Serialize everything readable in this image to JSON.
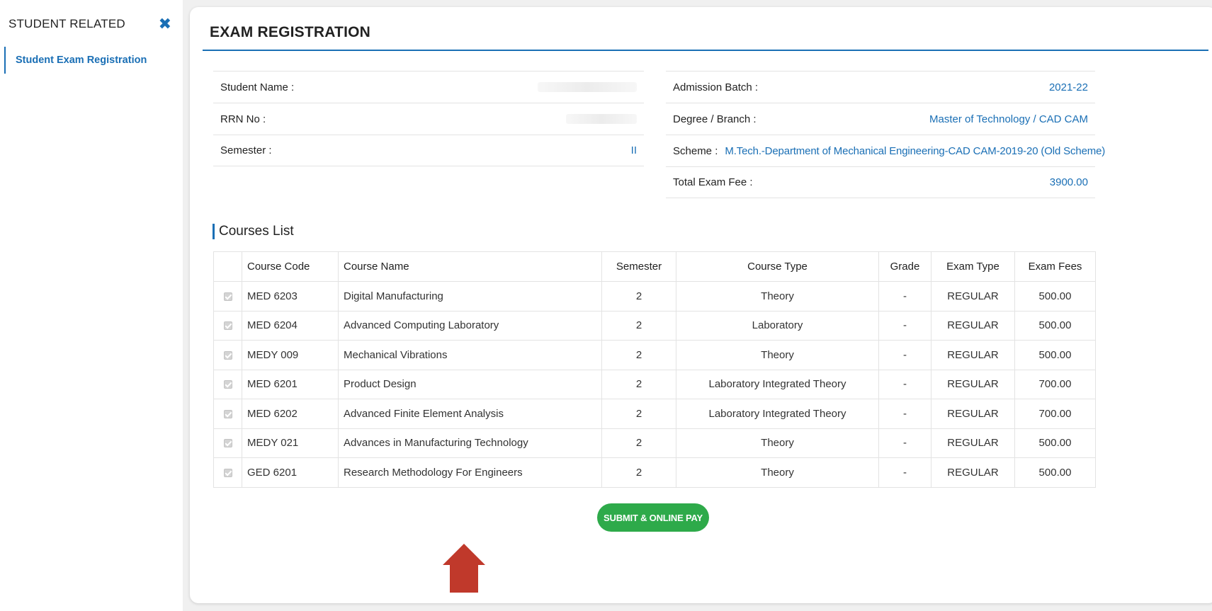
{
  "sidebar": {
    "title": "STUDENT RELATED",
    "close_icon": "✖",
    "items": [
      {
        "label": "Student Exam Registration"
      }
    ]
  },
  "main": {
    "title": "EXAM REGISTRATION",
    "info_left": [
      {
        "label": "Student Name :",
        "value": ""
      },
      {
        "label": "RRN No :",
        "value": ""
      },
      {
        "label": "Semester :",
        "value": "II"
      }
    ],
    "info_right": [
      {
        "label": "Admission Batch :",
        "value": "2021-22"
      },
      {
        "label": "Degree / Branch :",
        "value": "Master of Technology / CAD CAM"
      },
      {
        "label": "Scheme :",
        "value": "M.Tech.-Department of Mechanical Engineering-CAD CAM-2019-20 (Old Scheme)"
      },
      {
        "label": "Total Exam Fee :",
        "value": "3900.00"
      }
    ],
    "courses_heading": "Courses List",
    "table": {
      "headers": [
        "Course Code",
        "Course Name",
        "Semester",
        "Course Type",
        "Grade",
        "Exam Type",
        "Exam Fees"
      ],
      "rows": [
        {
          "code": "MED 6203",
          "name": "Digital Manufacturing",
          "semester": "2",
          "type": "Theory",
          "grade": "-",
          "exam_type": "REGULAR",
          "fees": "500.00",
          "checked": true
        },
        {
          "code": "MED 6204",
          "name": "Advanced Computing Laboratory",
          "semester": "2",
          "type": "Laboratory",
          "grade": "-",
          "exam_type": "REGULAR",
          "fees": "500.00",
          "checked": true
        },
        {
          "code": "MEDY 009",
          "name": "Mechanical Vibrations",
          "semester": "2",
          "type": "Theory",
          "grade": "-",
          "exam_type": "REGULAR",
          "fees": "500.00",
          "checked": true
        },
        {
          "code": "MED 6201",
          "name": "Product Design",
          "semester": "2",
          "type": "Laboratory Integrated Theory",
          "grade": "-",
          "exam_type": "REGULAR",
          "fees": "700.00",
          "checked": true
        },
        {
          "code": "MED 6202",
          "name": "Advanced Finite Element Analysis",
          "semester": "2",
          "type": "Laboratory Integrated Theory",
          "grade": "-",
          "exam_type": "REGULAR",
          "fees": "700.00",
          "checked": true
        },
        {
          "code": "MEDY 021",
          "name": "Advances in Manufacturing Technology",
          "semester": "2",
          "type": "Theory",
          "grade": "-",
          "exam_type": "REGULAR",
          "fees": "500.00",
          "checked": true
        },
        {
          "code": "GED 6201",
          "name": "Research Methodology For Engineers",
          "semester": "2",
          "type": "Theory",
          "grade": "-",
          "exam_type": "REGULAR",
          "fees": "500.00",
          "checked": true
        }
      ]
    },
    "submit_label": "SUBMIT & ONLINE PAY"
  },
  "colors": {
    "accent": "#1a6fb5",
    "submit": "#2eaa4a",
    "pointer": "#c0392b"
  }
}
